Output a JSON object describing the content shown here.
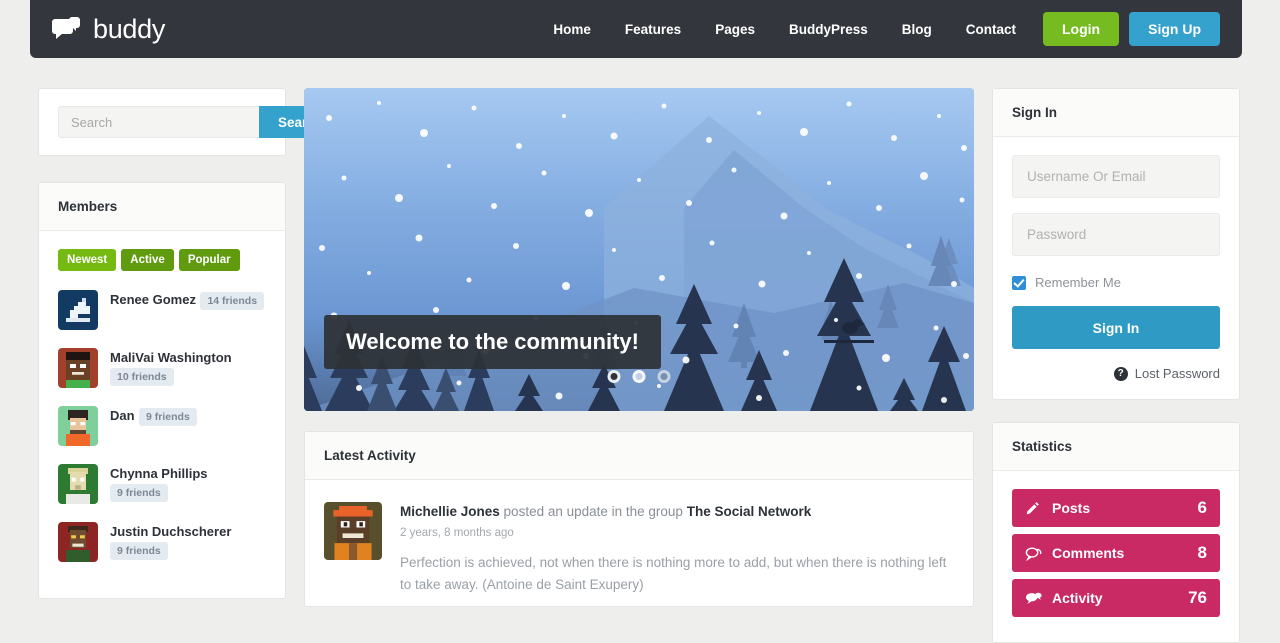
{
  "header": {
    "brand": "buddy",
    "brand_icon": "chat-bubbles-icon",
    "nav": [
      {
        "label": "Home"
      },
      {
        "label": "Features"
      },
      {
        "label": "Pages"
      },
      {
        "label": "BuddyPress"
      },
      {
        "label": "Blog"
      },
      {
        "label": "Contact"
      }
    ],
    "login_label": "Login",
    "signup_label": "Sign Up",
    "login_color": "#76bc21",
    "signup_color": "#35a2cd",
    "background_color": "#33373d"
  },
  "search": {
    "placeholder": "Search",
    "value": "",
    "button_label": "Search"
  },
  "members": {
    "title": "Members",
    "tabs": [
      {
        "label": "Newest",
        "active": true
      },
      {
        "label": "Active",
        "active": false
      },
      {
        "label": "Popular",
        "active": false
      }
    ],
    "list": [
      {
        "name": "Renee Gomez",
        "friends": "14 friends"
      },
      {
        "name": "MaliVai Washington",
        "friends": "10 friends"
      },
      {
        "name": "Dan",
        "friends": "9 friends"
      },
      {
        "name": "Chynna Phillips",
        "friends": "9 friends"
      },
      {
        "name": "Justin Duchscherer",
        "friends": "9 friends"
      }
    ]
  },
  "hero": {
    "caption": "Welcome to the community!",
    "slide_count": 3,
    "active_slide": 1,
    "scene": "winter-forest-snow"
  },
  "activity": {
    "title": "Latest Activity",
    "items": [
      {
        "author": "Michellie Jones",
        "action": " posted an update in the group ",
        "group": "The Social Network",
        "time": "2 years, 8 months ago",
        "text": "Perfection is achieved, not when there is nothing more to add, but when there is nothing left to take away. (Antoine de Saint Exupery)"
      }
    ]
  },
  "signin": {
    "title": "Sign In",
    "username_placeholder": "Username Or Email",
    "username_value": "",
    "password_placeholder": "Password",
    "password_value": "",
    "remember_label": "Remember Me",
    "remember_checked": true,
    "button_label": "Sign In",
    "lost_password_label": "Lost Password",
    "lost_password_icon": "question-circle-icon"
  },
  "statistics": {
    "title": "Statistics",
    "accent_color": "#c92a63",
    "items": [
      {
        "label": "Posts",
        "value": "6",
        "icon": "pencil-icon"
      },
      {
        "label": "Comments",
        "value": "8",
        "icon": "comment-outline-icon"
      },
      {
        "label": "Activity",
        "value": "76",
        "icon": "comments-filled-icon"
      }
    ]
  }
}
